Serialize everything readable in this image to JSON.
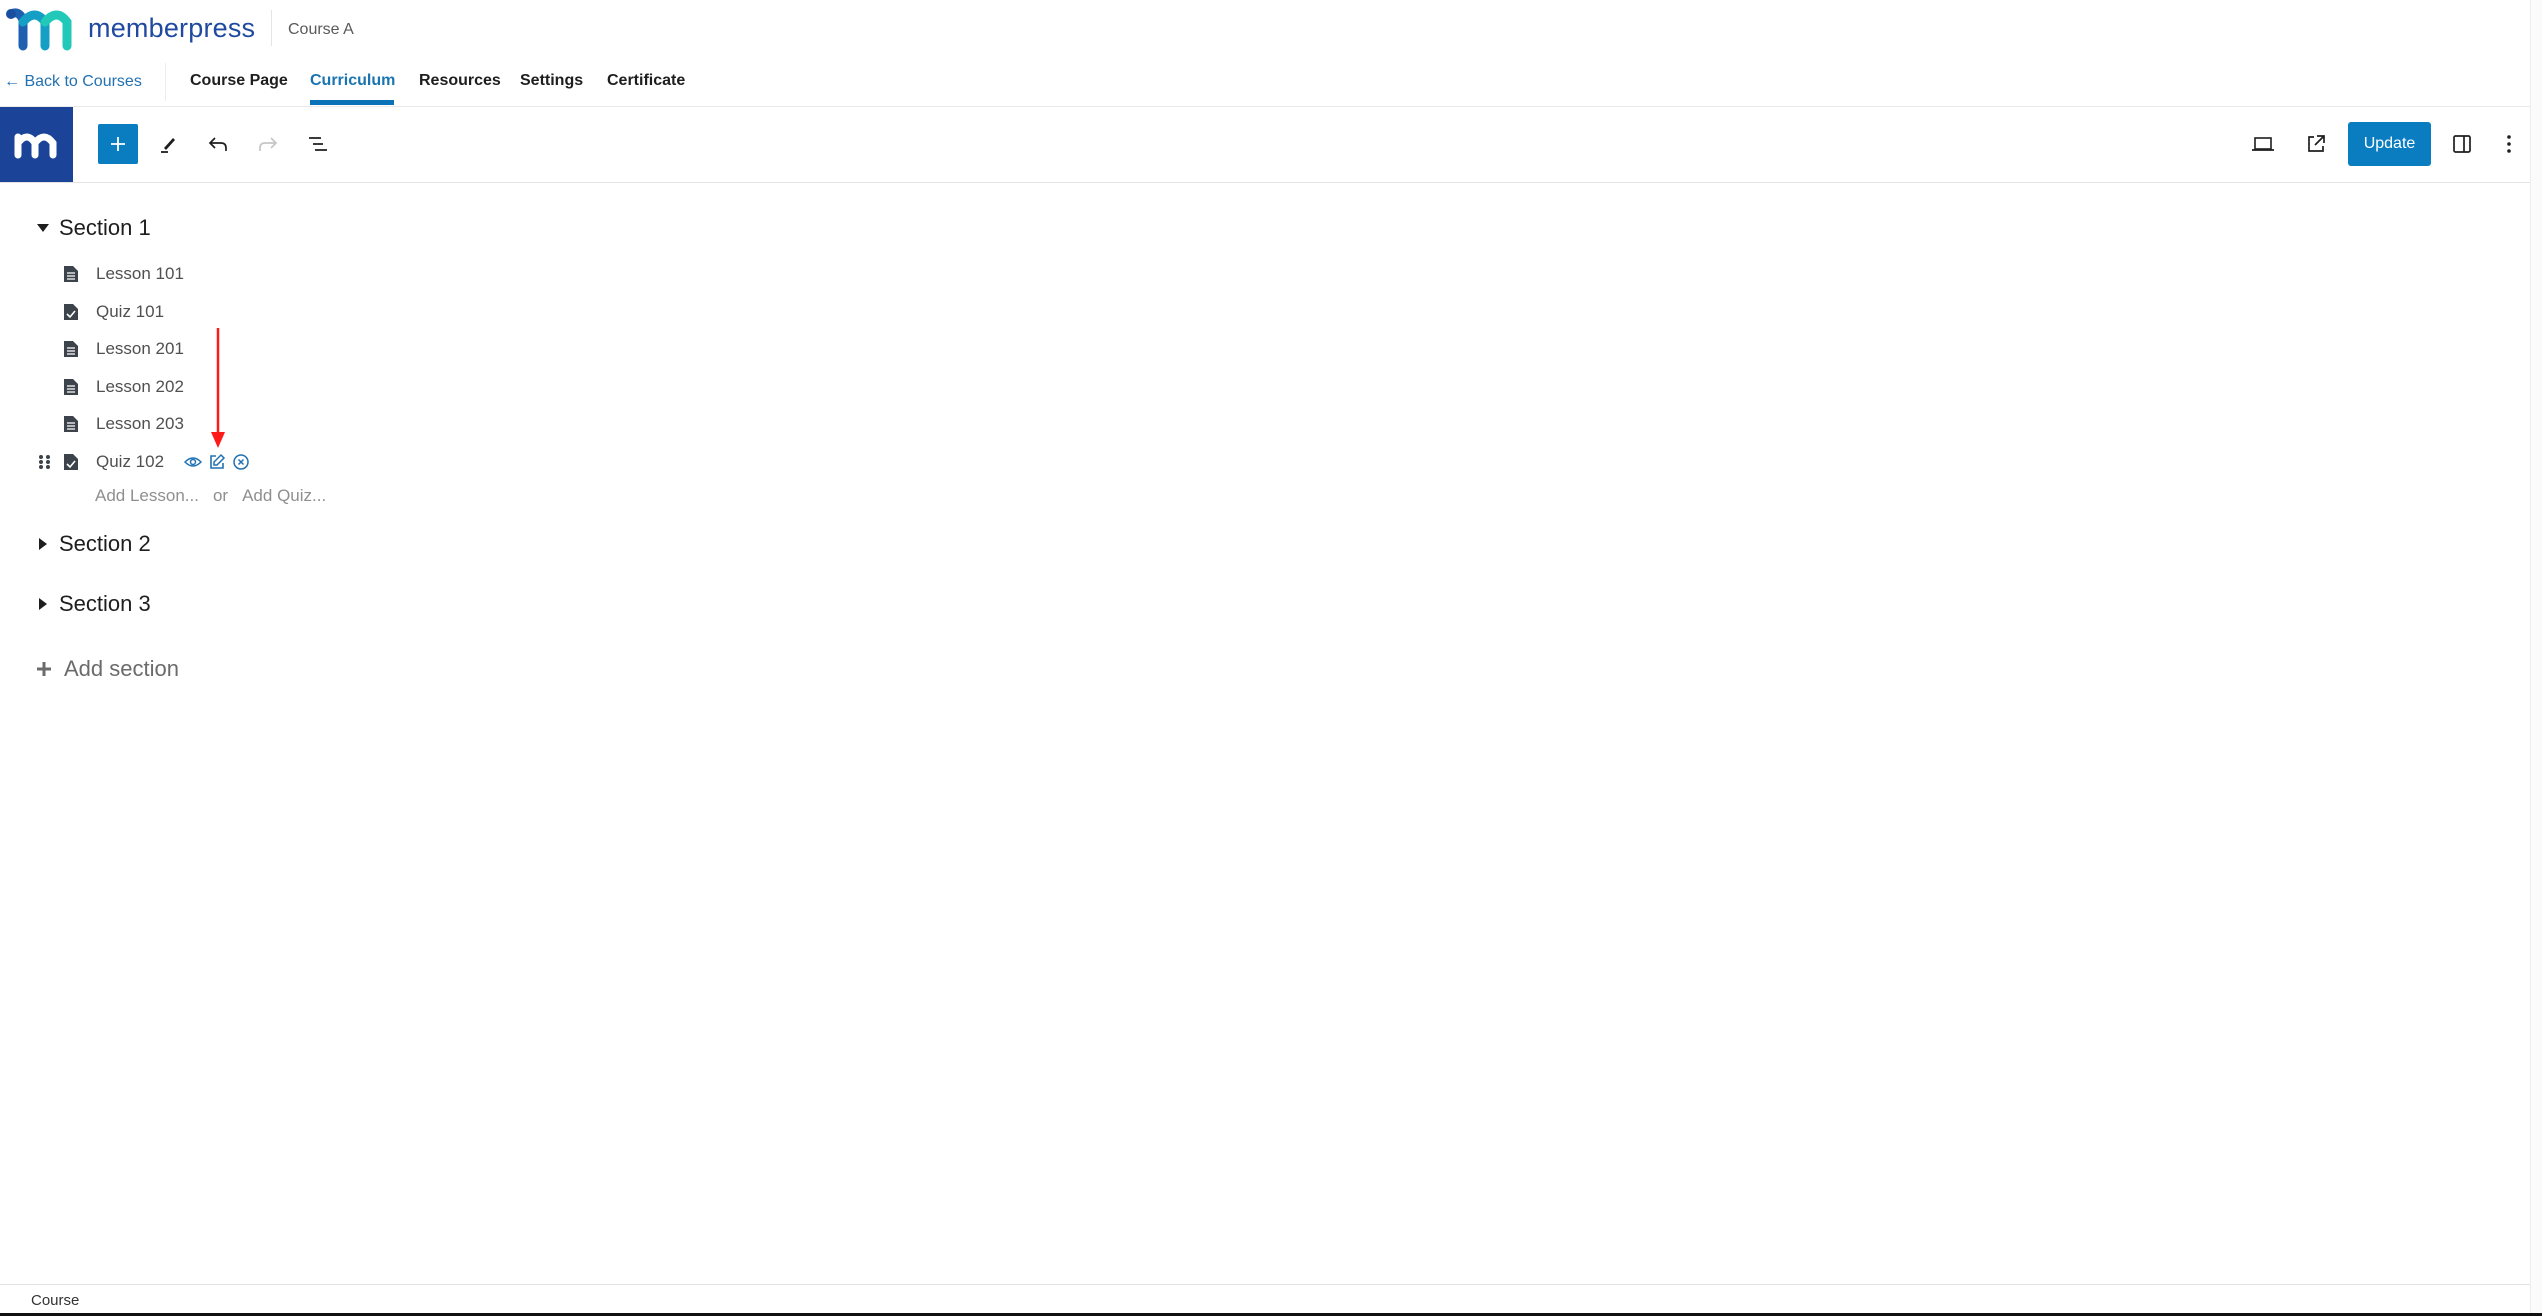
{
  "header": {
    "brand": "memberpress",
    "course_title": "Course A",
    "logo_colors": [
      "#1f5fb0",
      "#17a6c6",
      "#22c9b8"
    ]
  },
  "nav": {
    "back_link": "← Back to Courses",
    "tabs": [
      {
        "label": "Course Page",
        "active": false
      },
      {
        "label": "Curriculum",
        "active": true
      },
      {
        "label": "Resources",
        "active": false
      },
      {
        "label": "Settings",
        "active": false
      },
      {
        "label": "Certificate",
        "active": false
      }
    ]
  },
  "toolbar": {
    "left_icons": [
      "memberpress-logo-icon",
      "plus-icon",
      "pencil-icon",
      "undo-icon",
      "redo-icon",
      "list-view-icon"
    ],
    "right_icons": [
      "preview-laptop-icon",
      "external-link-icon",
      "sidebar-toggle-icon",
      "more-vertical-icon"
    ],
    "update_label": "Update",
    "accent": "#0a7dc0"
  },
  "curriculum": {
    "sections": [
      {
        "title": "Section 1",
        "expanded": true,
        "items": [
          {
            "type": "lesson",
            "label": "Lesson 101"
          },
          {
            "type": "quiz",
            "label": "Quiz 101"
          },
          {
            "type": "lesson",
            "label": "Lesson 201"
          },
          {
            "type": "lesson",
            "label": "Lesson 202"
          },
          {
            "type": "lesson",
            "label": "Lesson 203"
          },
          {
            "type": "quiz",
            "label": "Quiz 102",
            "hovered": true,
            "actions": [
              "view-icon",
              "edit-icon",
              "remove-icon"
            ]
          }
        ],
        "add_lesson": "Add Lesson...",
        "add_or": "or",
        "add_quiz": "Add Quiz..."
      },
      {
        "title": "Section 2",
        "expanded": false
      },
      {
        "title": "Section 3",
        "expanded": false
      }
    ],
    "add_section": "Add section"
  },
  "annotation": {
    "type": "red-arrow",
    "points_to": "edit-icon",
    "color": "#ff0000"
  },
  "footer": {
    "breadcrumb": "Course"
  }
}
